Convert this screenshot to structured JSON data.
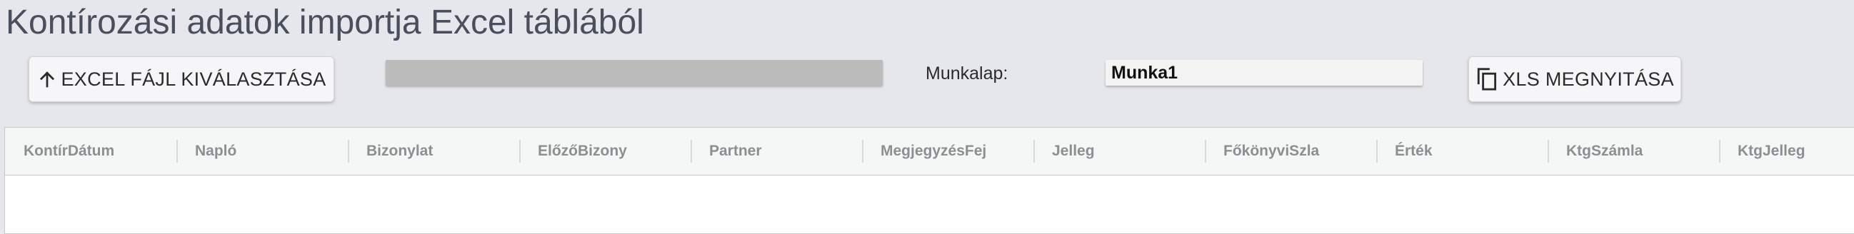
{
  "page": {
    "title": "Kontírozási adatok importja Excel táblából"
  },
  "toolbar": {
    "excel_button_label": "EXCEL FÁJL KIVÁLASZTÁSA",
    "excel_button_icon": "arrow-up-icon",
    "file_name": "",
    "sheet_label": "Munkalap:",
    "sheet_value": "Munka1",
    "xls_button_label": "XLS MEGNYITÁSA",
    "xls_button_icon": "copy-icon"
  },
  "grid": {
    "columns": [
      "KontírDátum",
      "Napló",
      "Bizonylat",
      "ElőzőBizony",
      "Partner",
      "MegjegyzésFej",
      "Jelleg",
      "FőkönyviSzla",
      "Érték",
      "KtgSzámla",
      "KtgJelleg"
    ],
    "rows": []
  },
  "colors": {
    "background": "#e6e7ec",
    "title": "#4a4f5e",
    "button_bg": "#f6f6f8",
    "file_bar": "#bbbbbb",
    "grid_header_bg": "#f5f6f6",
    "grid_header_text": "#8c8e92"
  }
}
